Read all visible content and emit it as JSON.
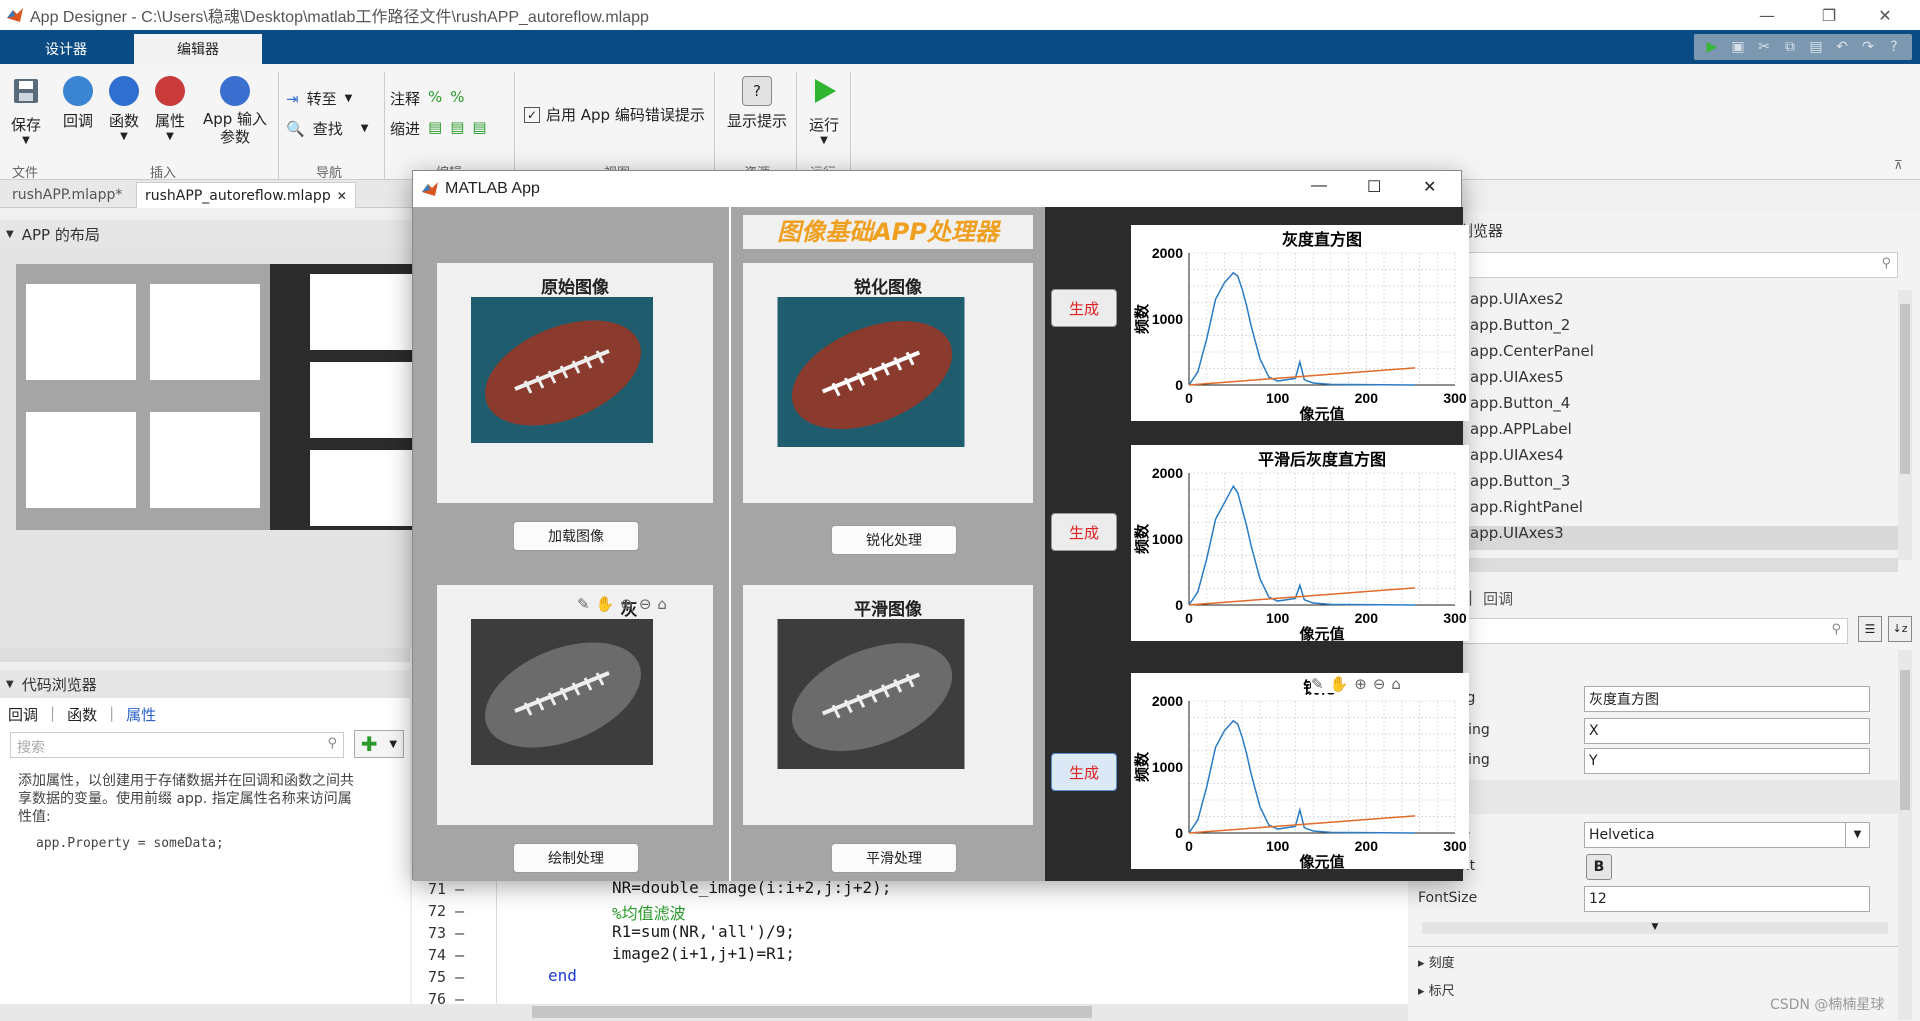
{
  "window": {
    "title": "App Designer - C:\\Users\\稳魂\\Desktop\\matlab工作路径文件\\rushAPP_autoreflow.mlapp"
  },
  "tabs": [
    {
      "label": "设计器"
    },
    {
      "label": "编辑器"
    }
  ],
  "ribbon": {
    "save": "保存",
    "callback": "回调",
    "function": "函数",
    "property": "属性",
    "app_input": "App 输入参数",
    "goto": "转至",
    "find": "查找",
    "comment": "注释",
    "indent": "缩进",
    "enable_hint": "启用 App 编码错误提示",
    "show_hints": "显示提示",
    "run": "运行",
    "groups": {
      "file": "文件",
      "insert": "插入",
      "nav": "导航",
      "edit": "编辑",
      "view": "视图",
      "resource": "资源",
      "run": "运行"
    }
  },
  "file_tabs": [
    {
      "label": "rushAPP.mlapp*"
    },
    {
      "label": "rushAPP_autoreflow.mlapp"
    }
  ],
  "layout_panel": {
    "title": "APP 的布局"
  },
  "code_browser": {
    "title": "代码浏览器",
    "tabs": [
      "回调",
      "函数",
      "属性"
    ],
    "search_placeholder": "搜索",
    "help": "添加属性，以创建用于存储数据并在回调和函数之间共享数据的变量。使用前缀 app. 指定属性名称来访问属性值:",
    "example": "app.Property = someData;"
  },
  "component_browser": {
    "title": "浏览器",
    "items": [
      "app.UIAxes2",
      "app.Button_2",
      "app.CenterPanel",
      "app.UIAxes5",
      "app.Button_4",
      "app.APPLabel",
      "app.UIAxes4",
      "app.Button_3",
      "app.RightPanel",
      "app.UIAxes3"
    ],
    "selected": "app.UIAxes3",
    "tab_callback": "回调"
  },
  "inspector": {
    "title_label": "ring",
    "title_value": "灰度直方图",
    "xlabel_label": "String",
    "xlabel_value": "X",
    "ylabel_label": "String",
    "ylabel_value": "Y",
    "fontname_label": "me",
    "fontname_value": "Helvetica",
    "fontweight_label": "ight",
    "fontweight_value": "B",
    "fontsize_label": "FontSize",
    "fontsize_value": "12",
    "sec_ticks": "刻度",
    "sec_label": "标尺"
  },
  "editor": {
    "lines": [
      {
        "no": "71",
        "code": "NR=double_image(i:i+2,j:j+2);"
      },
      {
        "no": "72",
        "code": "%均值滤波"
      },
      {
        "no": "73",
        "code": "R1=sum(NR,'all')/9;"
      },
      {
        "no": "74",
        "code": "image2(i+1,j+1)=R1;"
      },
      {
        "no": "75",
        "code": "end"
      },
      {
        "no": "76",
        "code": ""
      }
    ]
  },
  "matlab_app": {
    "title": "MATLAB App",
    "app_label": "图像基础APP处理器",
    "captions": {
      "original": "原始图像",
      "sharpen": "锐化图像",
      "gray": "灰",
      "smooth": "平滑图像"
    },
    "buttons": {
      "load": "加载图像",
      "sharpen": "锐化处理",
      "draw": "绘制处理",
      "smooth": "平滑处理",
      "gen1": "生成",
      "gen2": "生成",
      "gen3": "生成"
    },
    "axes": [
      {
        "title": "灰度直方图",
        "xlabel": "像元值",
        "ylabel": "频数"
      },
      {
        "title": "平滑后灰度直方图",
        "xlabel": "像元值",
        "ylabel": "频数"
      },
      {
        "title": "锐化l",
        "xlabel": "像元值",
        "ylabel": "频数"
      }
    ]
  },
  "chart_data": [
    {
      "type": "line",
      "title": "灰度直方图",
      "xlabel": "像元值",
      "ylabel": "频数",
      "xlim": [
        0,
        300
      ],
      "ylim": [
        0,
        2000
      ],
      "xticks": [
        0,
        100,
        200,
        300
      ],
      "yticks": [
        0,
        1000,
        2000
      ],
      "grid": true,
      "series": [
        {
          "color": "#2a7cc4",
          "x": [
            0,
            10,
            20,
            30,
            40,
            50,
            55,
            60,
            65,
            70,
            80,
            90,
            100,
            110,
            120,
            125,
            130,
            140,
            160,
            200,
            255
          ],
          "y": [
            0,
            200,
            700,
            1300,
            1550,
            1700,
            1650,
            1450,
            1200,
            900,
            400,
            120,
            60,
            80,
            100,
            350,
            80,
            30,
            10,
            5,
            0
          ]
        },
        {
          "color": "#e06a2a",
          "x": [
            0,
            255
          ],
          "y": [
            0,
            260
          ]
        }
      ]
    },
    {
      "type": "line",
      "title": "平滑后灰度直方图",
      "xlabel": "像元值",
      "ylabel": "频数",
      "xlim": [
        0,
        300
      ],
      "ylim": [
        0,
        2000
      ],
      "xticks": [
        0,
        100,
        200,
        300
      ],
      "yticks": [
        0,
        1000,
        2000
      ],
      "grid": true,
      "series": [
        {
          "color": "#2a7cc4",
          "x": [
            0,
            10,
            20,
            30,
            40,
            50,
            55,
            60,
            65,
            70,
            80,
            90,
            100,
            110,
            120,
            125,
            130,
            140,
            160,
            200,
            255
          ],
          "y": [
            0,
            200,
            700,
            1300,
            1550,
            1800,
            1700,
            1450,
            1200,
            900,
            400,
            120,
            60,
            80,
            100,
            300,
            80,
            30,
            10,
            5,
            0
          ]
        },
        {
          "color": "#e06a2a",
          "x": [
            0,
            255
          ],
          "y": [
            0,
            260
          ]
        }
      ]
    },
    {
      "type": "line",
      "title": "锐化l",
      "xlabel": "像元值",
      "ylabel": "频数",
      "xlim": [
        0,
        300
      ],
      "ylim": [
        0,
        2000
      ],
      "xticks": [
        0,
        100,
        200,
        300
      ],
      "yticks": [
        0,
        1000,
        2000
      ],
      "grid": true,
      "series": [
        {
          "color": "#2a7cc4",
          "x": [
            0,
            10,
            20,
            30,
            40,
            50,
            55,
            60,
            65,
            70,
            80,
            90,
            100,
            110,
            120,
            125,
            130,
            140,
            160,
            200,
            255
          ],
          "y": [
            0,
            200,
            700,
            1300,
            1550,
            1700,
            1650,
            1450,
            1200,
            900,
            400,
            120,
            60,
            80,
            100,
            350,
            80,
            30,
            10,
            5,
            0
          ]
        },
        {
          "color": "#e06a2a",
          "x": [
            0,
            255
          ],
          "y": [
            0,
            260
          ]
        }
      ]
    }
  ],
  "watermark": "CSDN @楠楠星球"
}
